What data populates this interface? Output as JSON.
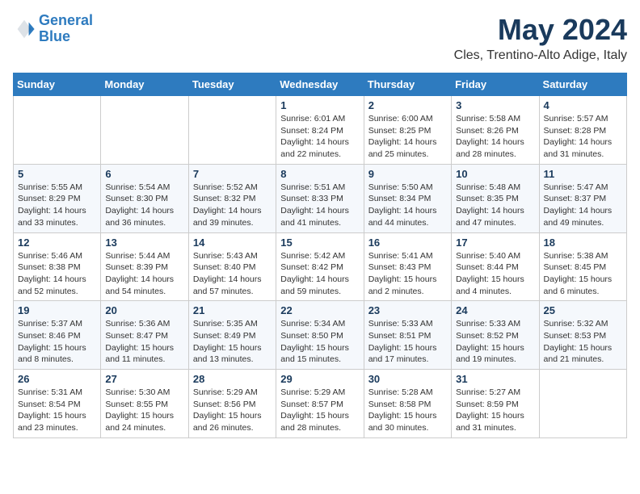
{
  "logo": {
    "line1": "General",
    "line2": "Blue"
  },
  "header": {
    "month": "May 2024",
    "location": "Cles, Trentino-Alto Adige, Italy"
  },
  "weekdays": [
    "Sunday",
    "Monday",
    "Tuesday",
    "Wednesday",
    "Thursday",
    "Friday",
    "Saturday"
  ],
  "weeks": [
    [
      {
        "day": "",
        "sunrise": "",
        "sunset": "",
        "daylight": ""
      },
      {
        "day": "",
        "sunrise": "",
        "sunset": "",
        "daylight": ""
      },
      {
        "day": "",
        "sunrise": "",
        "sunset": "",
        "daylight": ""
      },
      {
        "day": "1",
        "sunrise": "Sunrise: 6:01 AM",
        "sunset": "Sunset: 8:24 PM",
        "daylight": "Daylight: 14 hours and 22 minutes."
      },
      {
        "day": "2",
        "sunrise": "Sunrise: 6:00 AM",
        "sunset": "Sunset: 8:25 PM",
        "daylight": "Daylight: 14 hours and 25 minutes."
      },
      {
        "day": "3",
        "sunrise": "Sunrise: 5:58 AM",
        "sunset": "Sunset: 8:26 PM",
        "daylight": "Daylight: 14 hours and 28 minutes."
      },
      {
        "day": "4",
        "sunrise": "Sunrise: 5:57 AM",
        "sunset": "Sunset: 8:28 PM",
        "daylight": "Daylight: 14 hours and 31 minutes."
      }
    ],
    [
      {
        "day": "5",
        "sunrise": "Sunrise: 5:55 AM",
        "sunset": "Sunset: 8:29 PM",
        "daylight": "Daylight: 14 hours and 33 minutes."
      },
      {
        "day": "6",
        "sunrise": "Sunrise: 5:54 AM",
        "sunset": "Sunset: 8:30 PM",
        "daylight": "Daylight: 14 hours and 36 minutes."
      },
      {
        "day": "7",
        "sunrise": "Sunrise: 5:52 AM",
        "sunset": "Sunset: 8:32 PM",
        "daylight": "Daylight: 14 hours and 39 minutes."
      },
      {
        "day": "8",
        "sunrise": "Sunrise: 5:51 AM",
        "sunset": "Sunset: 8:33 PM",
        "daylight": "Daylight: 14 hours and 41 minutes."
      },
      {
        "day": "9",
        "sunrise": "Sunrise: 5:50 AM",
        "sunset": "Sunset: 8:34 PM",
        "daylight": "Daylight: 14 hours and 44 minutes."
      },
      {
        "day": "10",
        "sunrise": "Sunrise: 5:48 AM",
        "sunset": "Sunset: 8:35 PM",
        "daylight": "Daylight: 14 hours and 47 minutes."
      },
      {
        "day": "11",
        "sunrise": "Sunrise: 5:47 AM",
        "sunset": "Sunset: 8:37 PM",
        "daylight": "Daylight: 14 hours and 49 minutes."
      }
    ],
    [
      {
        "day": "12",
        "sunrise": "Sunrise: 5:46 AM",
        "sunset": "Sunset: 8:38 PM",
        "daylight": "Daylight: 14 hours and 52 minutes."
      },
      {
        "day": "13",
        "sunrise": "Sunrise: 5:44 AM",
        "sunset": "Sunset: 8:39 PM",
        "daylight": "Daylight: 14 hours and 54 minutes."
      },
      {
        "day": "14",
        "sunrise": "Sunrise: 5:43 AM",
        "sunset": "Sunset: 8:40 PM",
        "daylight": "Daylight: 14 hours and 57 minutes."
      },
      {
        "day": "15",
        "sunrise": "Sunrise: 5:42 AM",
        "sunset": "Sunset: 8:42 PM",
        "daylight": "Daylight: 14 hours and 59 minutes."
      },
      {
        "day": "16",
        "sunrise": "Sunrise: 5:41 AM",
        "sunset": "Sunset: 8:43 PM",
        "daylight": "Daylight: 15 hours and 2 minutes."
      },
      {
        "day": "17",
        "sunrise": "Sunrise: 5:40 AM",
        "sunset": "Sunset: 8:44 PM",
        "daylight": "Daylight: 15 hours and 4 minutes."
      },
      {
        "day": "18",
        "sunrise": "Sunrise: 5:38 AM",
        "sunset": "Sunset: 8:45 PM",
        "daylight": "Daylight: 15 hours and 6 minutes."
      }
    ],
    [
      {
        "day": "19",
        "sunrise": "Sunrise: 5:37 AM",
        "sunset": "Sunset: 8:46 PM",
        "daylight": "Daylight: 15 hours and 8 minutes."
      },
      {
        "day": "20",
        "sunrise": "Sunrise: 5:36 AM",
        "sunset": "Sunset: 8:47 PM",
        "daylight": "Daylight: 15 hours and 11 minutes."
      },
      {
        "day": "21",
        "sunrise": "Sunrise: 5:35 AM",
        "sunset": "Sunset: 8:49 PM",
        "daylight": "Daylight: 15 hours and 13 minutes."
      },
      {
        "day": "22",
        "sunrise": "Sunrise: 5:34 AM",
        "sunset": "Sunset: 8:50 PM",
        "daylight": "Daylight: 15 hours and 15 minutes."
      },
      {
        "day": "23",
        "sunrise": "Sunrise: 5:33 AM",
        "sunset": "Sunset: 8:51 PM",
        "daylight": "Daylight: 15 hours and 17 minutes."
      },
      {
        "day": "24",
        "sunrise": "Sunrise: 5:33 AM",
        "sunset": "Sunset: 8:52 PM",
        "daylight": "Daylight: 15 hours and 19 minutes."
      },
      {
        "day": "25",
        "sunrise": "Sunrise: 5:32 AM",
        "sunset": "Sunset: 8:53 PM",
        "daylight": "Daylight: 15 hours and 21 minutes."
      }
    ],
    [
      {
        "day": "26",
        "sunrise": "Sunrise: 5:31 AM",
        "sunset": "Sunset: 8:54 PM",
        "daylight": "Daylight: 15 hours and 23 minutes."
      },
      {
        "day": "27",
        "sunrise": "Sunrise: 5:30 AM",
        "sunset": "Sunset: 8:55 PM",
        "daylight": "Daylight: 15 hours and 24 minutes."
      },
      {
        "day": "28",
        "sunrise": "Sunrise: 5:29 AM",
        "sunset": "Sunset: 8:56 PM",
        "daylight": "Daylight: 15 hours and 26 minutes."
      },
      {
        "day": "29",
        "sunrise": "Sunrise: 5:29 AM",
        "sunset": "Sunset: 8:57 PM",
        "daylight": "Daylight: 15 hours and 28 minutes."
      },
      {
        "day": "30",
        "sunrise": "Sunrise: 5:28 AM",
        "sunset": "Sunset: 8:58 PM",
        "daylight": "Daylight: 15 hours and 30 minutes."
      },
      {
        "day": "31",
        "sunrise": "Sunrise: 5:27 AM",
        "sunset": "Sunset: 8:59 PM",
        "daylight": "Daylight: 15 hours and 31 minutes."
      },
      {
        "day": "",
        "sunrise": "",
        "sunset": "",
        "daylight": ""
      }
    ]
  ]
}
